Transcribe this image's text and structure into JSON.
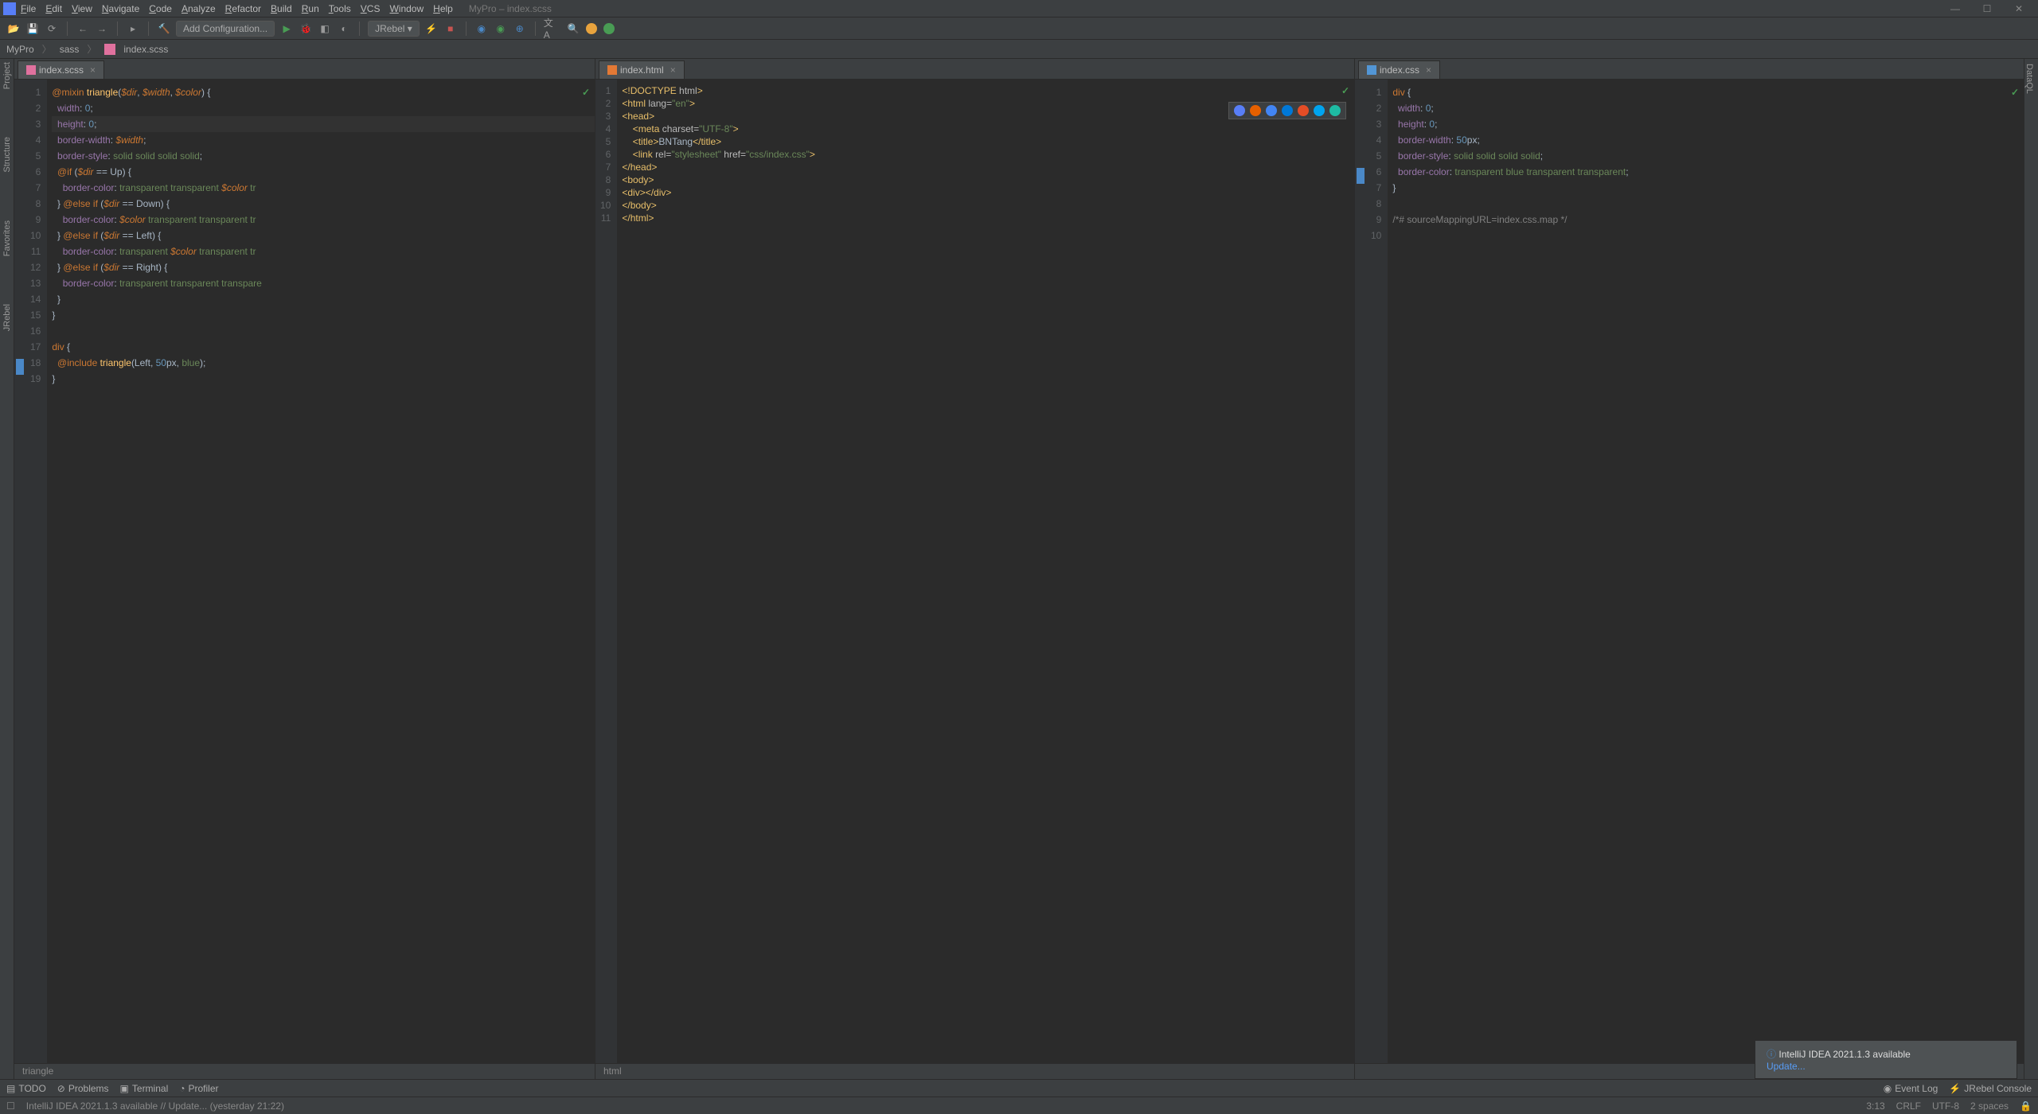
{
  "window": {
    "title": "MyPro – index.scss"
  },
  "menu": [
    "File",
    "Edit",
    "View",
    "Navigate",
    "Code",
    "Analyze",
    "Refactor",
    "Build",
    "Run",
    "Tools",
    "VCS",
    "Window",
    "Help"
  ],
  "toolbar": {
    "runconfig": "Add Configuration...",
    "jrebel": "JRebel"
  },
  "crumbs": [
    "MyPro",
    "sass",
    "index.scss"
  ],
  "lefttools": [
    "Project",
    "Structure",
    "Favorites",
    "JRebel"
  ],
  "tabs": {
    "p1": "index.scss",
    "p2": "index.html",
    "p3": "index.css"
  },
  "scss": {
    "lines": [
      [
        [
          "kw",
          "@mixin "
        ],
        [
          "fn",
          "triangle"
        ],
        [
          "p",
          "("
        ],
        [
          "var",
          "$dir"
        ],
        [
          "p",
          ", "
        ],
        [
          "var",
          "$width"
        ],
        [
          "p",
          ", "
        ],
        [
          "var",
          "$color"
        ],
        [
          "p",
          ") {"
        ]
      ],
      [
        [
          "p",
          "  "
        ],
        [
          "prop",
          "width"
        ],
        [
          "p",
          ": "
        ],
        [
          "num",
          "0"
        ],
        [
          "p",
          ";"
        ]
      ],
      [
        [
          "p",
          "  "
        ],
        [
          "prop",
          "height"
        ],
        [
          "p",
          ": "
        ],
        [
          "num",
          "0"
        ],
        [
          "p",
          ";"
        ]
      ],
      [
        [
          "p",
          "  "
        ],
        [
          "prop",
          "border-width"
        ],
        [
          "p",
          ": "
        ],
        [
          "var",
          "$width"
        ],
        [
          "p",
          ";"
        ]
      ],
      [
        [
          "p",
          "  "
        ],
        [
          "prop",
          "border-style"
        ],
        [
          "p",
          ": "
        ],
        [
          "str",
          "solid solid solid solid"
        ],
        [
          "p",
          ";"
        ]
      ],
      [
        [
          "p",
          "  "
        ],
        [
          "kw",
          "@if "
        ],
        [
          "p",
          "("
        ],
        [
          "var",
          "$dir"
        ],
        [
          "p",
          " == Up) {"
        ]
      ],
      [
        [
          "p",
          "    "
        ],
        [
          "prop",
          "border-color"
        ],
        [
          "p",
          ": "
        ],
        [
          "str",
          "transparent transparent "
        ],
        [
          "var",
          "$color"
        ],
        [
          "str",
          " tr"
        ]
      ],
      [
        [
          "p",
          "  } "
        ],
        [
          "kw",
          "@else if "
        ],
        [
          "p",
          "("
        ],
        [
          "var",
          "$dir"
        ],
        [
          "p",
          " == Down) {"
        ]
      ],
      [
        [
          "p",
          "    "
        ],
        [
          "prop",
          "border-color"
        ],
        [
          "p",
          ": "
        ],
        [
          "var",
          "$color"
        ],
        [
          "str",
          " transparent transparent tr"
        ]
      ],
      [
        [
          "p",
          "  } "
        ],
        [
          "kw",
          "@else if "
        ],
        [
          "p",
          "("
        ],
        [
          "var",
          "$dir"
        ],
        [
          "p",
          " == Left) {"
        ]
      ],
      [
        [
          "p",
          "    "
        ],
        [
          "prop",
          "border-color"
        ],
        [
          "p",
          ": "
        ],
        [
          "str",
          "transparent "
        ],
        [
          "var",
          "$color"
        ],
        [
          "str",
          " transparent tr"
        ]
      ],
      [
        [
          "p",
          "  } "
        ],
        [
          "kw",
          "@else if "
        ],
        [
          "p",
          "("
        ],
        [
          "var",
          "$dir"
        ],
        [
          "p",
          " == Right) {"
        ]
      ],
      [
        [
          "p",
          "    "
        ],
        [
          "prop",
          "border-color"
        ],
        [
          "p",
          ": "
        ],
        [
          "str",
          "transparent transparent transpare"
        ]
      ],
      [
        [
          "p",
          "  }"
        ]
      ],
      [
        [
          "p",
          "}"
        ]
      ],
      [
        [
          "p",
          ""
        ]
      ],
      [
        [
          "kw",
          "div "
        ],
        [
          "p",
          "{"
        ]
      ],
      [
        [
          "p",
          "  "
        ],
        [
          "kw",
          "@include "
        ],
        [
          "fn",
          "triangle"
        ],
        [
          "p",
          "(Left, "
        ],
        [
          "num",
          "50"
        ],
        [
          "p",
          "px, "
        ],
        [
          "str",
          "blue"
        ],
        [
          "p",
          ");"
        ]
      ],
      [
        [
          "p",
          "}"
        ]
      ]
    ],
    "current": 3
  },
  "html": {
    "lines": [
      [
        [
          "tag",
          "<!DOCTYPE "
        ],
        [
          "attr",
          "html"
        ],
        [
          "tag",
          ">"
        ]
      ],
      [
        [
          "tag",
          "<html "
        ],
        [
          "attr",
          "lang="
        ],
        [
          "str",
          "\"en\""
        ],
        [
          "tag",
          ">"
        ]
      ],
      [
        [
          "tag",
          "<head>"
        ]
      ],
      [
        [
          "p",
          "    "
        ],
        [
          "tag",
          "<meta "
        ],
        [
          "attr",
          "charset="
        ],
        [
          "str",
          "\"UTF-8\""
        ],
        [
          "tag",
          ">"
        ]
      ],
      [
        [
          "p",
          "    "
        ],
        [
          "tag",
          "<title>"
        ],
        [
          "p",
          "BNTang"
        ],
        [
          "tag",
          "</title>"
        ]
      ],
      [
        [
          "p",
          "    "
        ],
        [
          "tag",
          "<link "
        ],
        [
          "attr",
          "rel="
        ],
        [
          "str",
          "\"stylesheet\" "
        ],
        [
          "attr",
          "href="
        ],
        [
          "str",
          "\"css/index.css\""
        ],
        [
          "tag",
          ">"
        ]
      ],
      [
        [
          "tag",
          "</head>"
        ]
      ],
      [
        [
          "tag",
          "<body>"
        ]
      ],
      [
        [
          "tag",
          "<div></div>"
        ]
      ],
      [
        [
          "tag",
          "</body>"
        ]
      ],
      [
        [
          "tag",
          "</html>"
        ]
      ]
    ]
  },
  "css": {
    "lines": [
      [
        [
          "kw",
          "div "
        ],
        [
          "p",
          "{"
        ]
      ],
      [
        [
          "p",
          "  "
        ],
        [
          "prop",
          "width"
        ],
        [
          "p",
          ": "
        ],
        [
          "num",
          "0"
        ],
        [
          "p",
          ";"
        ]
      ],
      [
        [
          "p",
          "  "
        ],
        [
          "prop",
          "height"
        ],
        [
          "p",
          ": "
        ],
        [
          "num",
          "0"
        ],
        [
          "p",
          ";"
        ]
      ],
      [
        [
          "p",
          "  "
        ],
        [
          "prop",
          "border-width"
        ],
        [
          "p",
          ": "
        ],
        [
          "num",
          "50"
        ],
        [
          "p",
          "px;"
        ]
      ],
      [
        [
          "p",
          "  "
        ],
        [
          "prop",
          "border-style"
        ],
        [
          "p",
          ": "
        ],
        [
          "str",
          "solid solid solid solid"
        ],
        [
          "p",
          ";"
        ]
      ],
      [
        [
          "p",
          "  "
        ],
        [
          "prop",
          "border-color"
        ],
        [
          "p",
          ": "
        ],
        [
          "str",
          "transparent blue transparent transparent"
        ],
        [
          "p",
          ";"
        ]
      ],
      [
        [
          "p",
          "}"
        ]
      ],
      [
        [
          "p",
          ""
        ]
      ],
      [
        [
          "cmt",
          "/*# sourceMappingURL=index.css.map */"
        ]
      ],
      [
        [
          "p",
          ""
        ]
      ]
    ]
  },
  "bc": {
    "p1": "triangle",
    "p2": "html"
  },
  "bottom": [
    "TODO",
    "Problems",
    "Terminal",
    "Profiler"
  ],
  "bottomright": [
    "Event Log",
    "JRebel Console"
  ],
  "status": {
    "msg": "IntelliJ IDEA 2021.1.3 available // Update... (yesterday 21:22)",
    "pos": "3:13",
    "le": "CRLF",
    "enc": "UTF-8",
    "ind": "2 spaces"
  },
  "notif": {
    "title": "IntelliJ IDEA 2021.1.3 available",
    "link": "Update..."
  },
  "browsers": [
    "#587ef7",
    "#e66000",
    "#4285f4",
    "#0078d7",
    "#e44d26",
    "#00a4ef",
    "#1ebba3"
  ]
}
